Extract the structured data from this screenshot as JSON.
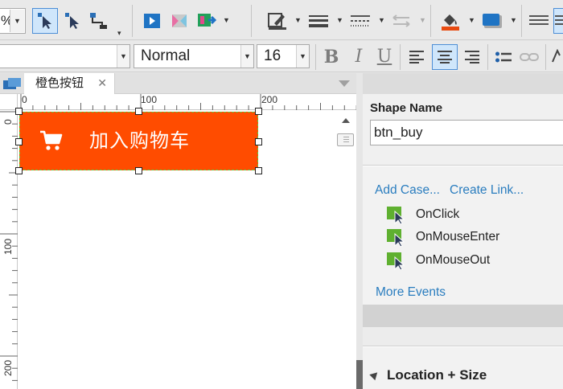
{
  "toolbar": {
    "zoom_value": "%",
    "font_family": "",
    "font_style": "Normal",
    "font_size": "16",
    "bold": "B",
    "italic": "I",
    "underline": "U"
  },
  "tabs": [
    {
      "label": "橙色按钮",
      "close": "✕"
    }
  ],
  "ruler": {
    "h_labels": [
      "0",
      "100",
      "200"
    ],
    "v_labels": [
      "0",
      "100",
      "200"
    ]
  },
  "canvas": {
    "button_label": "加入购物车",
    "button_color": "#ff4c00"
  },
  "panel": {
    "shape_name_label": "Shape Name",
    "shape_name_value": "btn_buy",
    "add_case": "Add Case...",
    "create_link": "Create Link...",
    "events": [
      "OnClick",
      "OnMouseEnter",
      "OnMouseOut"
    ],
    "more_events": "More Events",
    "location_size": "Location + Size"
  },
  "colors": {
    "accent": "#2a7dbf",
    "selection": "#cfe6fb",
    "brand_orange": "#ff4c00",
    "event_green": "#5fb030"
  }
}
